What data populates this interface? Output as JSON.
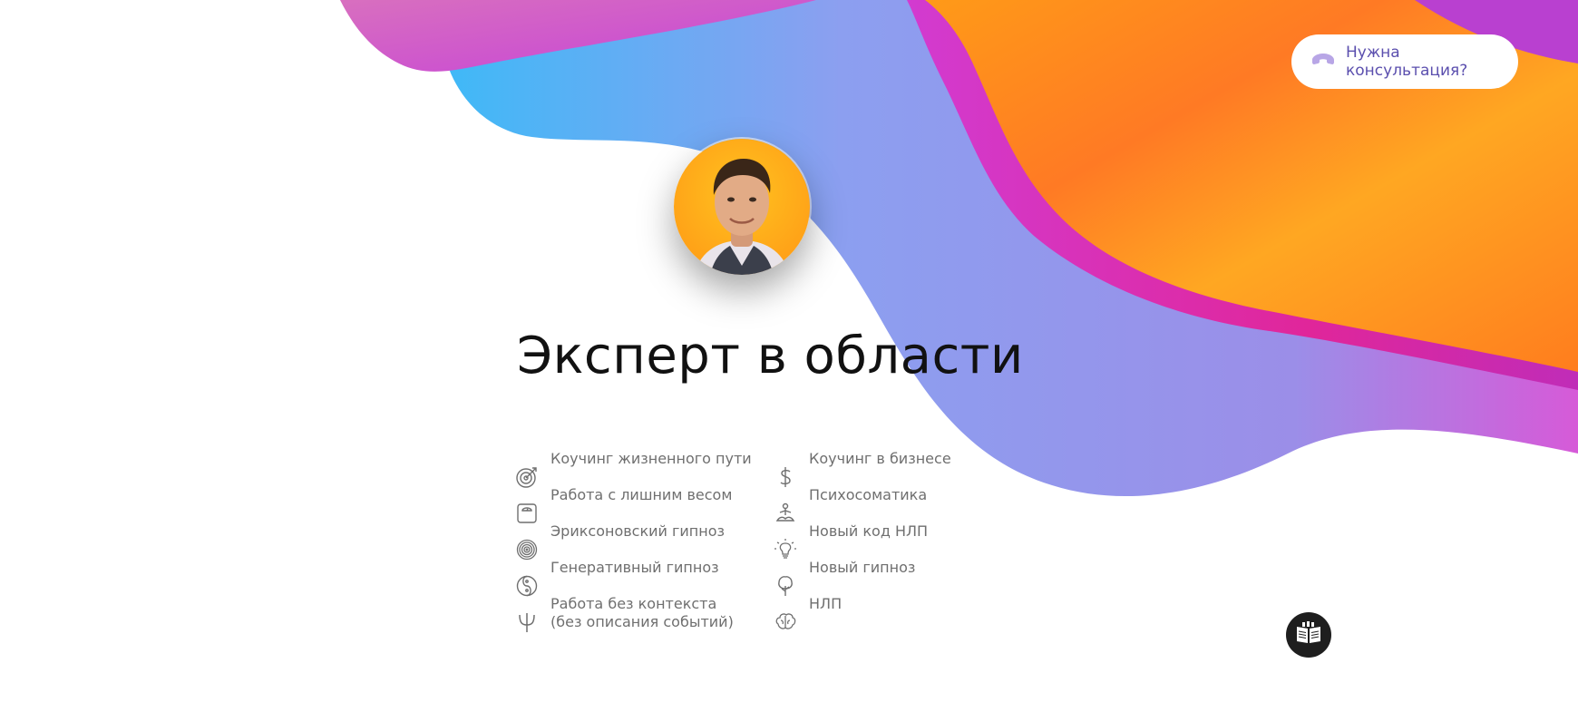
{
  "header": {
    "consult_button_label": "Нужна консультация?",
    "phone_icon": "phone-icon"
  },
  "hero": {
    "title": "Эксперт в области",
    "avatar": "avatar-photo"
  },
  "skills": [
    {
      "label": "Коучинг жизненного пути",
      "icon": "target-icon"
    },
    {
      "label": "Коучинг в бизнесе",
      "icon": "dollar-icon"
    },
    {
      "label": "Работа с лишним весом",
      "icon": "scale-icon"
    },
    {
      "label": "Психосоматика",
      "icon": "meditation-icon"
    },
    {
      "label": "Эриксоновский гипноз",
      "icon": "spiral-icon"
    },
    {
      "label": "Новый код НЛП",
      "icon": "lightbulb-icon"
    },
    {
      "label": "Генеративный гипноз",
      "icon": "yin-yang-icon"
    },
    {
      "label": "Новый гипноз",
      "icon": "tree-icon"
    },
    {
      "label": "Работа без контекста\n(без описания событий)",
      "icon": "psi-icon"
    },
    {
      "label": "НЛП",
      "icon": "brain-icon"
    }
  ],
  "colors": {
    "accent": "#5b4fae",
    "text": "#6f6f6f",
    "title": "#111111",
    "orange": "#ff8a1c",
    "magenta": "#d22fb8",
    "blue": "#4fb8f5"
  },
  "floating": {
    "book_icon": "book-icon"
  }
}
